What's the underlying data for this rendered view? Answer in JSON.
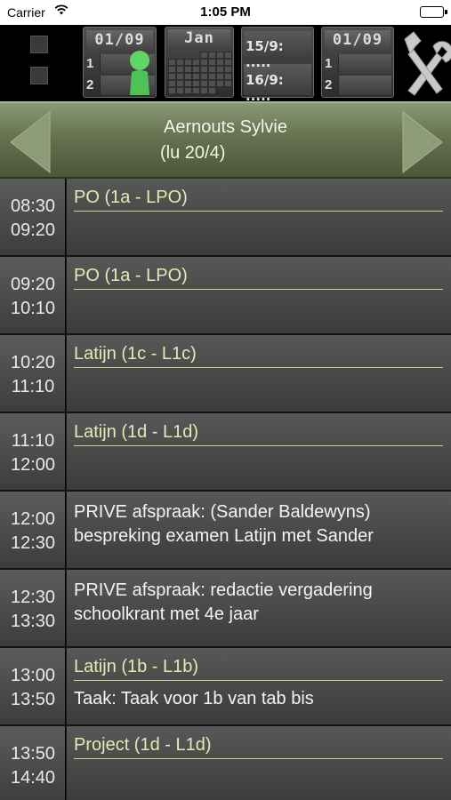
{
  "status": {
    "carrier": "Carrier",
    "time": "1:05 PM"
  },
  "toolbar": {
    "tile1": {
      "date": "01/09",
      "row1": "1",
      "row2": "2"
    },
    "tile2": {
      "month": "Jan"
    },
    "tile3": {
      "line1": "15/9: .....",
      "line2": "16/9: ....."
    },
    "tile4": {
      "date": "01/09",
      "row1": "1",
      "row2": "2"
    }
  },
  "header": {
    "name": "Aernouts Sylvie",
    "date": "(lu 20/4)"
  },
  "schedule": [
    {
      "start": "08:30",
      "end": "09:20",
      "subject": "PO (1a - LPO)"
    },
    {
      "start": "09:20",
      "end": "10:10",
      "subject": "PO (1a - LPO)"
    },
    {
      "start": "10:20",
      "end": "11:10",
      "subject": "Latijn (1c - L1c)"
    },
    {
      "start": "11:10",
      "end": "12:00",
      "subject": "Latijn (1d - L1d)"
    },
    {
      "start": "12:00",
      "end": "12:30",
      "note1": "PRIVE afspraak: (Sander Baldewyns)",
      "note2": "bespreking examen Latijn met Sander"
    },
    {
      "start": "12:30",
      "end": "13:30",
      "note1": "PRIVE afspraak: redactie vergadering",
      "note2": "schoolkrant met 4e jaar"
    },
    {
      "start": "13:00",
      "end": "13:50",
      "subject": "Latijn (1b - L1b)",
      "note": "Taak: Taak voor 1b van tab bis"
    },
    {
      "start": "13:50",
      "end": "14:40",
      "subject": "Project (1d - L1d)"
    }
  ]
}
